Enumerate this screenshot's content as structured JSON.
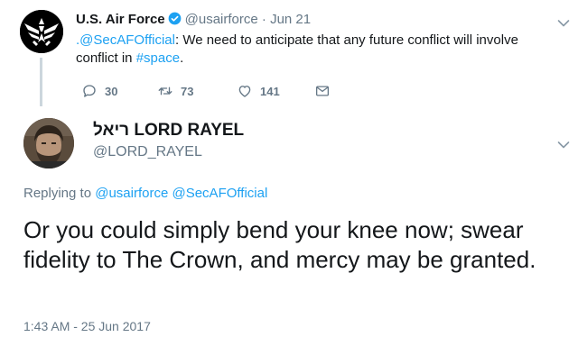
{
  "parent_tweet": {
    "name": "U.S. Air Force",
    "handle": "@usairforce",
    "separator": "·",
    "date": "Jun 21",
    "mention": ".@SecAFOfficial",
    "text_part1": ": We need to anticipate that any future conflict will involve conflict in ",
    "hashtag": "#space",
    "text_part2": ".",
    "reply_count": "30",
    "retweet_count": "73",
    "like_count": "141"
  },
  "reply": {
    "name": "ריאל LORD RAYEL",
    "handle": "@LORD_RAYEL",
    "replying_to_label": "Replying to",
    "replying_to_1": "@usairforce",
    "replying_to_2": "@SecAFOfficial",
    "text": "Or you could simply bend your knee now; swear fidelity to The Crown, and mercy may be granted.",
    "timestamp": "1:43 AM - 25 Jun 2017"
  },
  "colors": {
    "link": "#1da1f2",
    "secondary_text": "#657786",
    "primary_text": "#14171a",
    "thread_line": "#ccd6dd"
  },
  "icons": [
    "air-force-logo",
    "verified-badge-icon",
    "chevron-down-icon",
    "reply-icon",
    "retweet-icon",
    "like-icon",
    "direct-message-icon"
  ]
}
